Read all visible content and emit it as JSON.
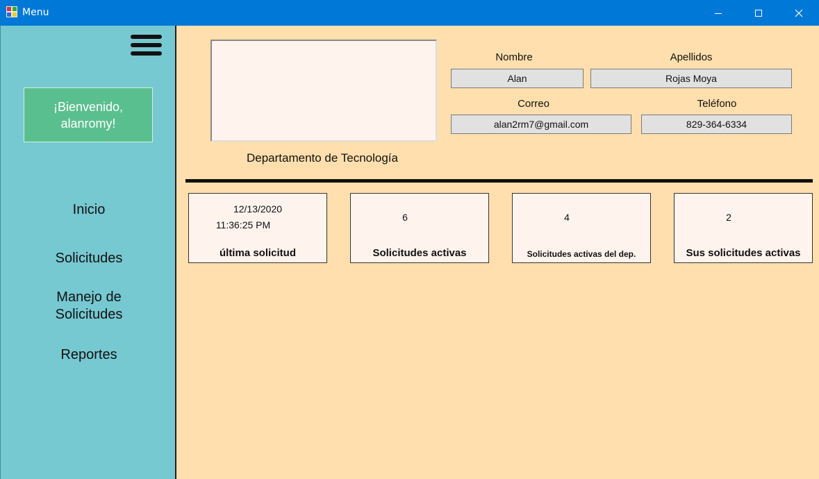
{
  "window": {
    "title": "Menu",
    "accent": "#0078D7",
    "controls": [
      "minimize-icon",
      "maximize-icon",
      "close-icon"
    ]
  },
  "sidebar": {
    "background": "#76C8D1",
    "welcome": "¡Bienvenido,\nalanromy!",
    "items": [
      {
        "label": "Inicio"
      },
      {
        "label": "Solicitudes"
      },
      {
        "label": "Manejo de\nSolicitudes"
      },
      {
        "label": "Reportes"
      }
    ]
  },
  "profile": {
    "department": "Departamento de Tecnología",
    "fields": {
      "nombre_label": "Nombre",
      "nombre_value": "Alan",
      "apellidos_label": "Apellidos",
      "apellidos_value": "Rojas Moya",
      "correo_label": "Correo",
      "correo_value": "alan2rm7@gmail.com",
      "telefono_label": "Teléfono",
      "telefono_value": "829-364-6334"
    }
  },
  "cards": [
    {
      "value_line1": "12/13/2020",
      "value_line2": "11:36:25 PM",
      "caption": "última solicitud"
    },
    {
      "value": "6",
      "caption": "Solicitudes activas"
    },
    {
      "value": "4",
      "caption": "Solicitudes activas del dep."
    },
    {
      "value": "2",
      "caption": "Sus solicitudes activas"
    }
  ]
}
